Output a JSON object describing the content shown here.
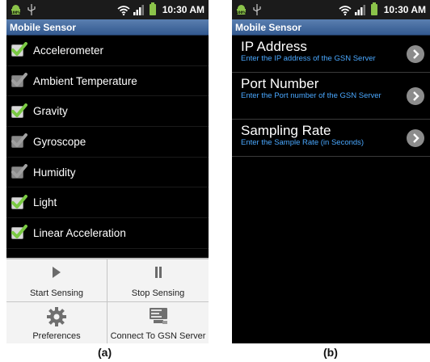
{
  "status_bar": {
    "android_text": "100%",
    "time": "10:30 AM"
  },
  "screen_a": {
    "app_title": "Mobile Sensor",
    "sensors": [
      {
        "label": "Accelerometer",
        "checked": true
      },
      {
        "label": "Ambient Temperature",
        "checked": false
      },
      {
        "label": "Gravity",
        "checked": true
      },
      {
        "label": "Gyroscope",
        "checked": false
      },
      {
        "label": "Humidity",
        "checked": false
      },
      {
        "label": "Light",
        "checked": true
      },
      {
        "label": "Linear Acceleration",
        "checked": true
      }
    ],
    "menu": [
      {
        "label": "Start Sensing",
        "icon": "play-icon"
      },
      {
        "label": "Stop Sensing",
        "icon": "pause-icon"
      },
      {
        "label": "Preferences",
        "icon": "gear-icon"
      },
      {
        "label": "Connect To GSN Server",
        "icon": "server-icon"
      }
    ],
    "caption": "(a)"
  },
  "screen_b": {
    "app_title": "Mobile Sensor",
    "settings": [
      {
        "title": "IP Address",
        "subtitle": "Enter the IP address of the GSN Server"
      },
      {
        "title": "Port Number",
        "subtitle": "Enter the Port number of the GSN Server"
      },
      {
        "title": "Sampling Rate",
        "subtitle": "Enter the Sample Rate (in Seconds)"
      }
    ],
    "caption": "(b)"
  },
  "colors": {
    "check_green": "#7ac943",
    "link_blue": "#4aa8ff",
    "title_bar_blue": "#3d6398"
  }
}
